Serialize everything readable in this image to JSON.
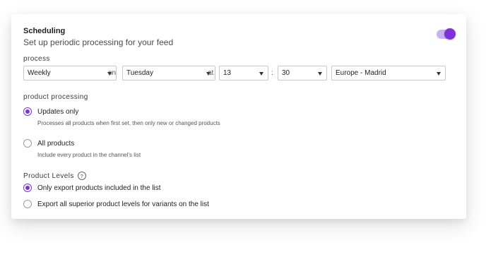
{
  "scheduling": {
    "title": "Scheduling",
    "subtitle": "Set up periodic processing for your feed",
    "enabled": true
  },
  "process": {
    "label": "process",
    "frequency": "Weekly",
    "on_word": "on",
    "day": "Tuesday",
    "at_word": "at",
    "hour": "13",
    "colon": ":",
    "minute": "30",
    "timezone": "Europe - Madrid"
  },
  "product_processing": {
    "label": "product processing",
    "options": [
      {
        "label": "Updates only",
        "description": "Processes all products when first set, then only new or changed products",
        "checked": true
      },
      {
        "label": "All products",
        "description": "Include every product in the channel's list",
        "checked": false
      }
    ]
  },
  "product_levels": {
    "label": "Product Levels",
    "help_icon": "?",
    "options": [
      {
        "label": "Only export products included in the list",
        "checked": true
      },
      {
        "label": "Export all superior product levels for variants on the list",
        "checked": false
      }
    ]
  },
  "colors": {
    "accent": "#7b34d9",
    "toggle_track": "#c9b3ef"
  }
}
